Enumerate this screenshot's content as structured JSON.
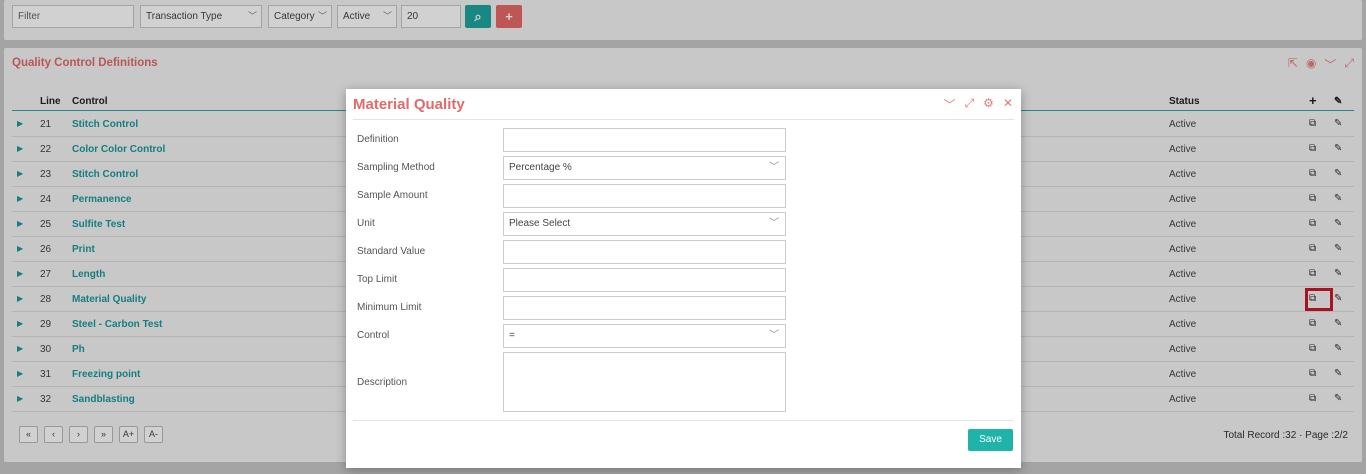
{
  "toolbar": {
    "filter_placeholder": "Filter",
    "transaction_type": "Transaction Type",
    "category": "Category",
    "status": "Active",
    "page_size": "20",
    "search_icon": "search-icon",
    "add_icon": "plus-icon"
  },
  "panel": {
    "title": "Quality Control Definitions",
    "columns": {
      "line": "Line",
      "control": "Control",
      "status": "Status"
    },
    "rows": [
      {
        "line": "21",
        "control": "Stitch Control",
        "status": "Active"
      },
      {
        "line": "22",
        "control": "Color Color Control",
        "status": "Active"
      },
      {
        "line": "23",
        "control": "Stitch Control",
        "status": "Active"
      },
      {
        "line": "24",
        "control": "Permanence",
        "status": "Active"
      },
      {
        "line": "25",
        "control": "Sulfite Test",
        "status": "Active"
      },
      {
        "line": "26",
        "control": "Print",
        "status": "Active"
      },
      {
        "line": "27",
        "control": "Length",
        "status": "Active"
      },
      {
        "line": "28",
        "control": "Material Quality",
        "status": "Active"
      },
      {
        "line": "29",
        "control": "Steel - Carbon Test",
        "status": "Active"
      },
      {
        "line": "30",
        "control": "Ph",
        "status": "Active"
      },
      {
        "line": "31",
        "control": "Freezing point",
        "status": "Active"
      },
      {
        "line": "32",
        "control": "Sandblasting",
        "status": "Active"
      }
    ],
    "pager": [
      "«",
      "‹",
      "›",
      "»",
      "A+",
      "A-"
    ],
    "total": "Total Record :32 · Page :2/2"
  },
  "modal": {
    "title": "Material Quality",
    "fields": {
      "definition": {
        "label": "Definition",
        "value": ""
      },
      "sampling_method": {
        "label": "Sampling Method",
        "value": "Percentage %"
      },
      "sample_amount": {
        "label": "Sample Amount",
        "value": ""
      },
      "unit": {
        "label": "Unit",
        "value": "Please Select"
      },
      "standard_value": {
        "label": "Standard Value",
        "value": ""
      },
      "top_limit": {
        "label": "Top Limit",
        "value": ""
      },
      "minimum_limit": {
        "label": "Minimum Limit",
        "value": ""
      },
      "control": {
        "label": "Control",
        "value": "="
      },
      "description": {
        "label": "Description",
        "value": ""
      }
    },
    "save_label": "Save"
  },
  "colors": {
    "accent": "#1fb3aa",
    "title_red": "#e36a6a",
    "highlight": "#d0162a"
  }
}
